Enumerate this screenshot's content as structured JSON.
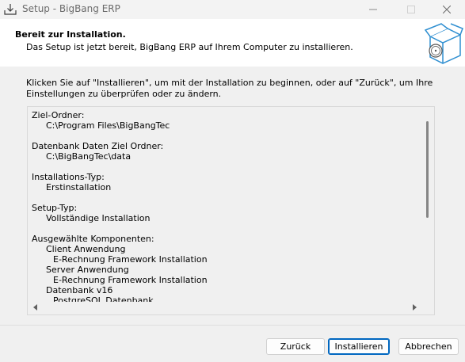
{
  "window": {
    "title": "Setup - BigBang ERP",
    "icon": "download-tray-icon"
  },
  "header": {
    "title": "Bereit zur Installation.",
    "subtitle": "Das Setup ist jetzt bereit, BigBang ERP auf Ihrem Computer zu installieren.",
    "image_icon": "software-box-icon"
  },
  "instructions": "Klicken Sie auf \"Installieren\", um mit der Installation zu beginnen, oder auf \"Zurück\", um Ihre Einstellungen zu überprüfen oder zu ändern.",
  "summary": {
    "target_folder_label": "Ziel-Ordner:",
    "target_folder_value": "C:\\Program Files\\BigBangTec",
    "db_folder_label": "Datenbank Daten Ziel Ordner:",
    "db_folder_value": "C:\\BigBangTec\\data",
    "install_type_label": "Installations-Typ:",
    "install_type_value": "Erstinstallation",
    "setup_type_label": "Setup-Typ:",
    "setup_type_value": "Vollständige Installation",
    "components_label": "Ausgewählte Komponenten:",
    "components": [
      {
        "name": "Client Anwendung",
        "sub": "E-Rechnung Framework Installation"
      },
      {
        "name": "Server Anwendung",
        "sub": "E-Rechnung Framework Installation"
      },
      {
        "name": "Datenbank v16",
        "sub": "PostgreSQL Datenbank"
      }
    ]
  },
  "buttons": {
    "back": "Zurück",
    "install": "Installieren",
    "cancel": "Abbrechen"
  },
  "colors": {
    "accent": "#0067c0"
  }
}
